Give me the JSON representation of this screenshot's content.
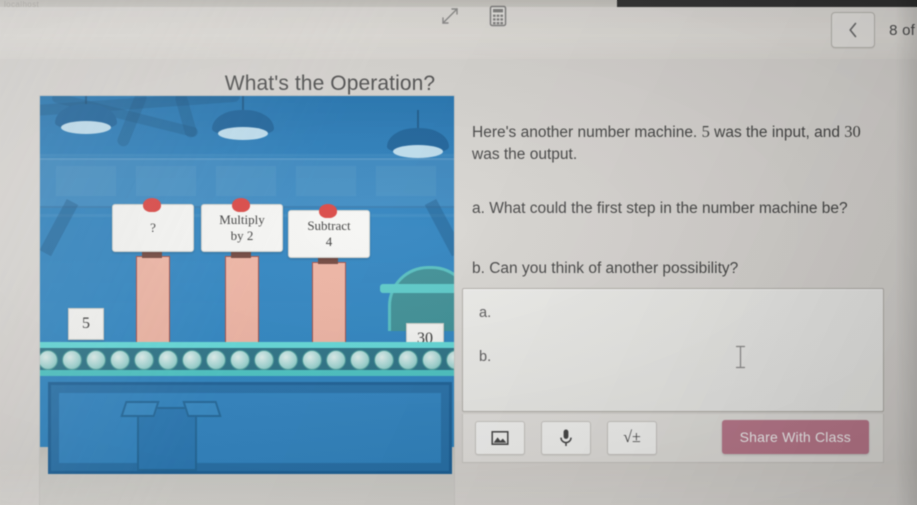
{
  "browser": {
    "ghost_text": "localhost"
  },
  "topbar": {
    "expand_icon": "expand-arrows-icon",
    "calculator_icon": "calculator-icon",
    "back_icon": "chevron-left-icon",
    "page_count": "8 of"
  },
  "page": {
    "title": "What's the Operation?"
  },
  "question": {
    "intro_before": "Here's another number machine.",
    "input_value": "5",
    "intro_mid": "was the input,",
    "intro_line2_before": "and",
    "output_value": "30",
    "intro_line2_after": "was the output.",
    "part_a": "a. What could the first step in the number machine be?",
    "part_b": "b. Can you think of another possibility?"
  },
  "answer": {
    "label_a": "a.",
    "label_b": "b.",
    "value_a": "",
    "value_b": "",
    "placeholder": ""
  },
  "toolbar": {
    "image_icon": "image-icon",
    "mic_icon": "microphone-icon",
    "math_icon": "math-formula-icon",
    "math_glyph": "√±",
    "share_label": "Share With Class"
  },
  "illustration": {
    "name": "number-machine-factory",
    "signs": [
      {
        "line1": "?",
        "line2": ""
      },
      {
        "line1": "Multiply",
        "line2": "by 2"
      },
      {
        "line1": "Subtract",
        "line2": "4"
      }
    ],
    "input_card": "5",
    "output_card": "30",
    "colors": {
      "wall": "#1f83c9",
      "wall_dark": "#1472b8",
      "machine_box": "#f7b4a0",
      "machine_outline": "#a8453b",
      "belt_rail": "#57e0de",
      "belt_body": "#1d6f86",
      "lamp_shade": "#0d5e9e",
      "lamp_bulb": "#bfe3f6",
      "pin": "#e53935",
      "arch": "#2f8f96"
    }
  },
  "colors": {
    "share_button": "#c4798f",
    "page_bg": "#e4e1dc",
    "text": "#3d3d3d"
  }
}
